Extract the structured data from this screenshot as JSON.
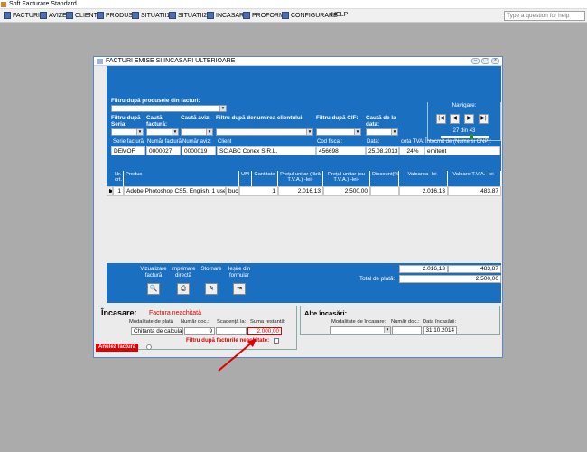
{
  "app": {
    "title": "Soft Facturare Standard"
  },
  "menu": {
    "items": [
      "FACTURI",
      "AVIZE",
      "CLIENTI",
      "PRODUSE",
      "SITUATII1",
      "SITUATII2",
      "INCASARI",
      "PROFORME",
      "CONFIGURARE",
      "HELP"
    ],
    "help_placeholder": "Type a question for help"
  },
  "window": {
    "title": "FACTURI EMISE SI INCASARI ULTERIOARE",
    "heading": "FACTURI EMISE ȘI ÎNCASARI ULTERIOARE"
  },
  "filters": {
    "product_label": "Filtru după produsele din facturi:",
    "series_label": "Filtru după Seria:",
    "invoice_search_label": "Caută factură:",
    "aviz_search_label": "Caută aviz:",
    "client_label": "Filtru după denumirea clientului:",
    "cif_label": "Filtru după CIF:",
    "date_label": "Caută de la data:"
  },
  "navigation": {
    "label": "Navigare:",
    "current": "27",
    "of": "din",
    "total": "43",
    "position_fraction": 0.63
  },
  "invoice": {
    "headers": [
      "Serie factură",
      "Număr factură",
      "Număr aviz:",
      "Client",
      "Cod fiscal:",
      "Data:",
      "cota TVA:",
      "Întocmit de (Nume si CNP):"
    ],
    "values": [
      "DEMOF",
      "0000027",
      "0000019",
      "SC ABC Conex S.R.L.",
      "456698",
      "25.08.2013",
      "24%",
      "emitent"
    ]
  },
  "grid": {
    "columns": [
      "Nr. crt.",
      "Produs",
      "UM",
      "Cantitate",
      "Prețul unitar (fără T.V.A.) -lei-",
      "Prețul unitar (cu T.V.A.) -lei-",
      "Discount(%)",
      "Valoarea -lei-",
      "Valoare T.V.A. -lei-"
    ],
    "rows": [
      [
        "1",
        "Adobe Photoshop CS5, English, 1 user, retail",
        "buc",
        "1",
        "2.016,13",
        "2.500,00",
        "",
        "2.016,13",
        "483,87"
      ]
    ]
  },
  "actions": {
    "view_label": "Vizualizare factură",
    "print_label": "Imprimare directă",
    "cancel_label": "Stornare",
    "exit_label": "Ieșire din formular"
  },
  "totals": {
    "valoare": "2.016,13",
    "tva": "483,87",
    "total_label": "Total de plată:",
    "total": "2.500,00"
  },
  "incasare": {
    "title": "Încasare:",
    "status": "Factura neachitată",
    "col_labels": [
      "Modalitate de plată",
      "Număr doc.:",
      "Scadență la:",
      "Suma restantă:"
    ],
    "payment_method": "Chitanta de calculator",
    "doc_number": "9",
    "due": "",
    "remaining": "2.000,00",
    "cancel_button": "Anulez factura",
    "filter_unpaid_label": "Filtru după facturile neachitate:"
  },
  "alte_incasari": {
    "title": "Alte încasări:",
    "col_labels": [
      "Modalitate de încasare:",
      "Număr doc.:",
      "Data încasării:"
    ],
    "date": "31.10.2014"
  },
  "colors": {
    "accent_blue": "#1a6fc1",
    "alert_red": "#e00000"
  }
}
